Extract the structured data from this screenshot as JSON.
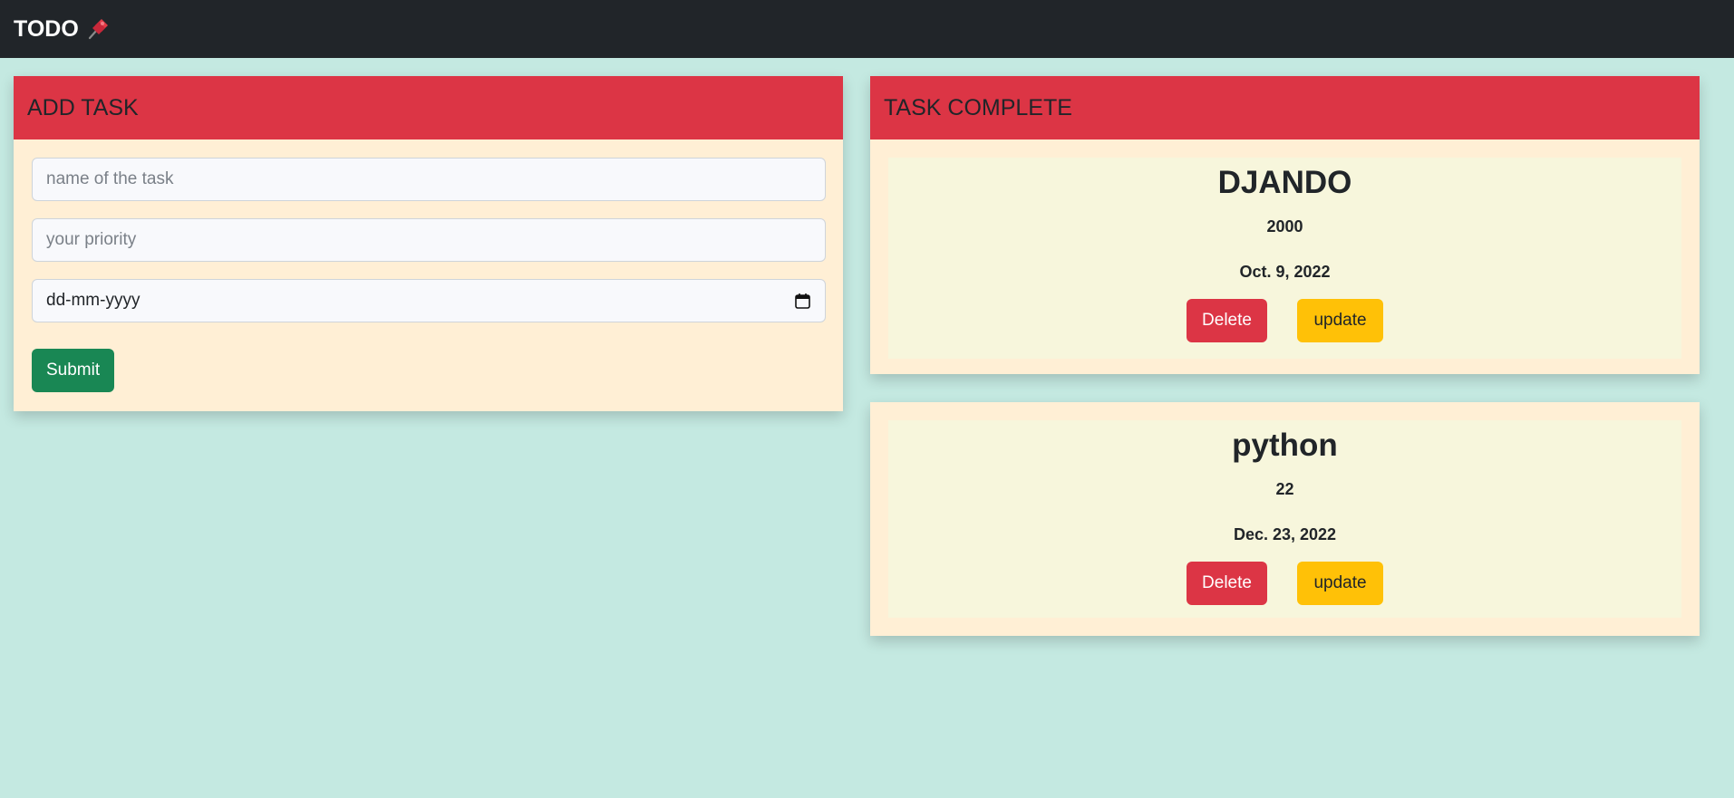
{
  "navbar": {
    "brand": "TODO",
    "brand_icon": "pushpin-icon"
  },
  "add_task": {
    "header": "ADD TASK",
    "name_placeholder": "name of the task",
    "priority_placeholder": "your priority",
    "date_placeholder": "dd-mm-yyyy",
    "submit_label": "Submit"
  },
  "task_complete": {
    "header": "TASK COMPLETE"
  },
  "tasks": [
    {
      "title": "DJANDO",
      "priority": "2000",
      "date": "Oct. 9, 2022",
      "delete_label": "Delete",
      "update_label": "update"
    },
    {
      "title": "python",
      "priority": "22",
      "date": "Dec. 23, 2022",
      "delete_label": "Delete",
      "update_label": "update"
    }
  ],
  "colors": {
    "background": "#c4e9e1",
    "navbar": "#212529",
    "header": "#dc3545",
    "card": "#ffefd5",
    "task_inner": "#f7f6dc",
    "submit": "#198754",
    "delete": "#dc3545",
    "update": "#ffc107"
  }
}
